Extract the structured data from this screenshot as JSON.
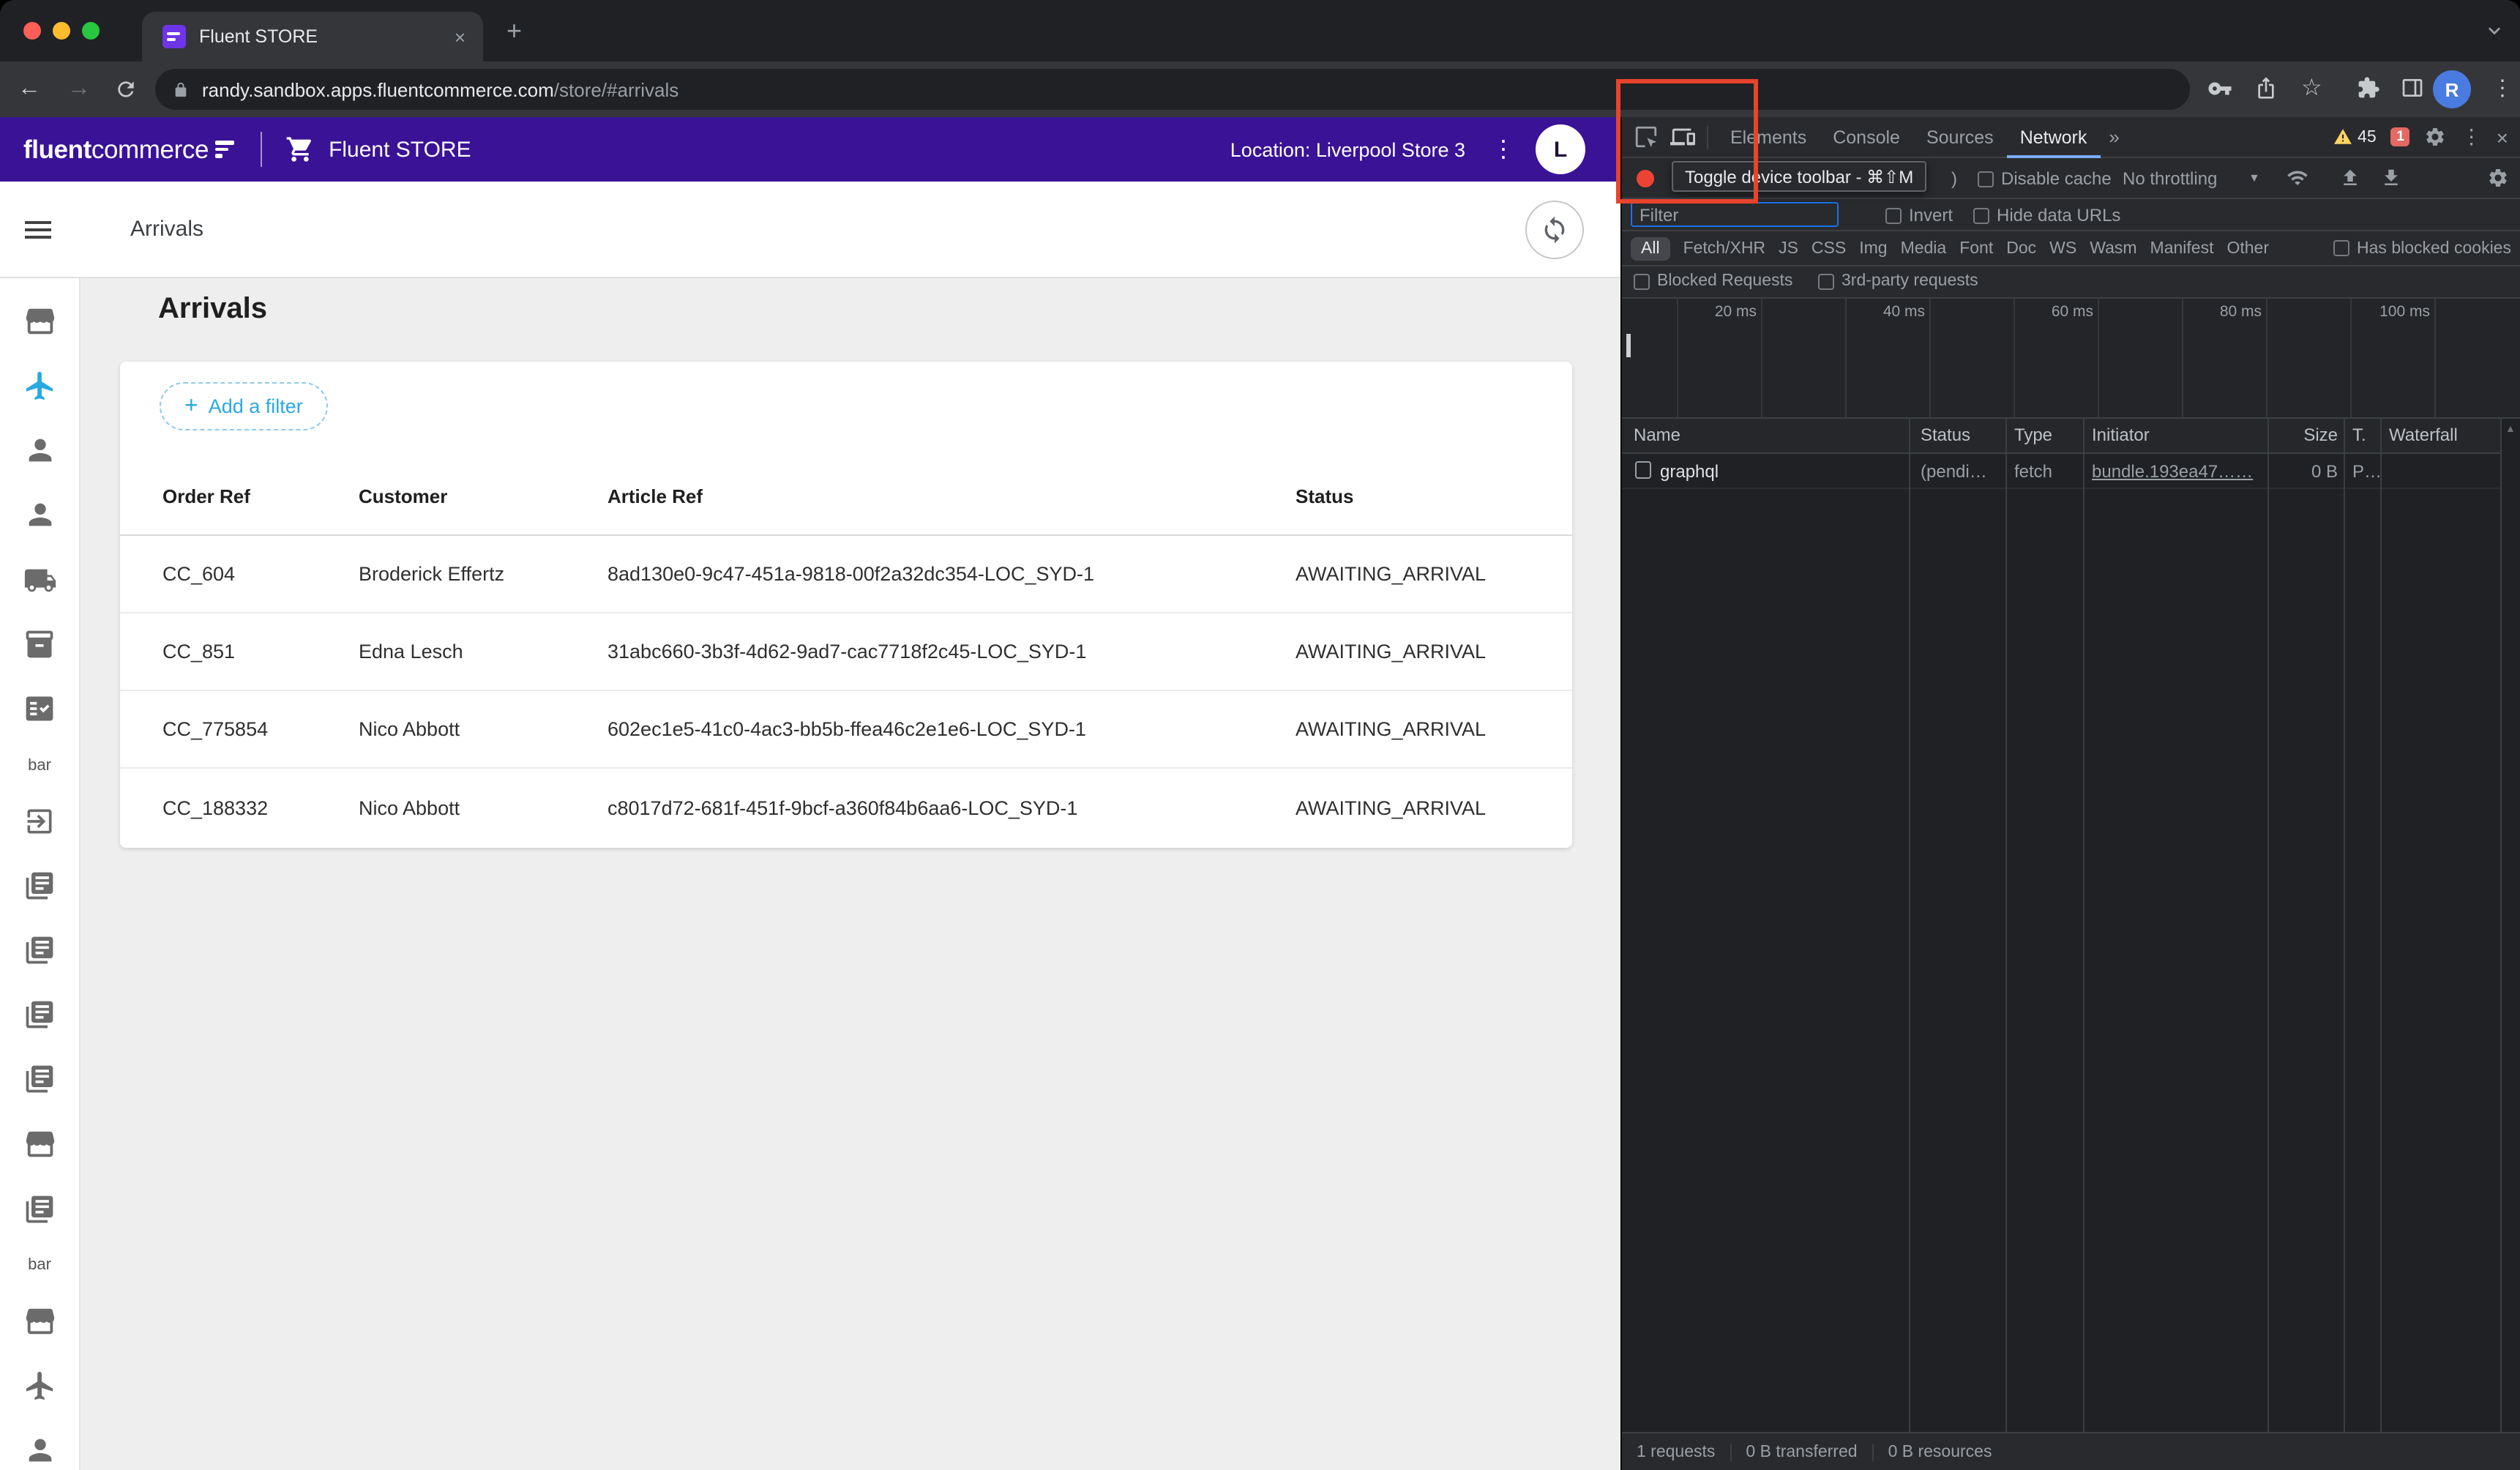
{
  "browser": {
    "tab_title": "Fluent STORE",
    "url_domain": "randy.sandbox.apps.fluentcommerce.com",
    "url_path": "/store/#arrivals",
    "profile_initial": "R"
  },
  "glyphs": {
    "back": "←",
    "forward": "→",
    "star": "☆",
    "kebab": "⋮",
    "close": "×",
    "new_tab": "+",
    "more_tabs": "»",
    "caret_down": "▼",
    "sort_up": "▲",
    "plus": "+"
  },
  "colors": {
    "brand_purple": "#3a1296",
    "accent_blue": "#29a9e2",
    "devtools_warning": "#fdd663",
    "devtools_issue": "#e46962",
    "annotation_red": "#e8432c"
  },
  "app": {
    "header": {
      "logo_bold": "fluent",
      "logo_light": "commerce",
      "product": "Fluent STORE",
      "location": "Location: Liverpool Store 3",
      "avatar_initial": "L"
    },
    "toolbar": {
      "title": "Arrivals"
    },
    "sidebar": {
      "bar_label": "bar",
      "items": [
        "storefront-icon",
        "flight-icon",
        "person-icon",
        "person-icon",
        "truck-icon",
        "package-icon",
        "fact-check-icon",
        "bar-label",
        "exit-icon",
        "library-icon",
        "library-icon",
        "library-icon",
        "library-icon",
        "storefront-icon",
        "library-icon",
        "bar-label",
        "storefront-icon",
        "flight-icon",
        "person-icon"
      ]
    },
    "page": {
      "heading": "Arrivals",
      "add_filter": "Add a filter"
    },
    "table": {
      "columns": [
        "Order Ref",
        "Customer",
        "Article Ref",
        "Status"
      ],
      "rows": [
        {
          "order_ref": "CC_604",
          "customer": "Broderick Effertz",
          "article_ref": "8ad130e0-9c47-451a-9818-00f2a32dc354-LOC_SYD-1",
          "status": "AWAITING_ARRIVAL"
        },
        {
          "order_ref": "CC_851",
          "customer": "Edna Lesch",
          "article_ref": "31abc660-3b3f-4d62-9ad7-cac7718f2c45-LOC_SYD-1",
          "status": "AWAITING_ARRIVAL"
        },
        {
          "order_ref": "CC_775854",
          "customer": "Nico Abbott",
          "article_ref": "602ec1e5-41c0-4ac3-bb5b-ffea46c2e1e6-LOC_SYD-1",
          "status": "AWAITING_ARRIVAL"
        },
        {
          "order_ref": "CC_188332",
          "customer": "Nico Abbott",
          "article_ref": "c8017d72-681f-451f-9bcf-a360f84b6aa6-LOC_SYD-1",
          "status": "AWAITING_ARRIVAL"
        }
      ]
    }
  },
  "devtools": {
    "panel_tabs": [
      "Elements",
      "Console",
      "Sources",
      "Network"
    ],
    "active_tab": "Network",
    "warning_count": "45",
    "issue_count": "1",
    "tooltip": "Toggle device toolbar - ⌘⇧M",
    "network_bar": {
      "obscured_fragment": ")",
      "disable_cache": "Disable cache",
      "throttling": "No throttling"
    },
    "filter_bar": {
      "placeholder": "Filter",
      "invert": "Invert",
      "hide_data_urls": "Hide data URLs"
    },
    "chips": [
      "All",
      "Fetch/XHR",
      "JS",
      "CSS",
      "Img",
      "Media",
      "Font",
      "Doc",
      "WS",
      "Wasm",
      "Manifest",
      "Other"
    ],
    "has_blocked_cookies": "Has blocked cookies",
    "checks_row": {
      "blocked_requests": "Blocked Requests",
      "third_party": "3rd-party requests"
    },
    "timeline": {
      "labels": [
        "20 ms",
        "40 ms",
        "60 ms",
        "80 ms",
        "100 ms"
      ]
    },
    "network": {
      "columns": [
        "Name",
        "Status",
        "Type",
        "Initiator",
        "Size",
        "T.",
        "Waterfall"
      ],
      "rows": [
        {
          "name": "graphql",
          "status": "(pendi…",
          "type": "fetch",
          "initiator": "bundle.193ea47……",
          "size": "0 B",
          "time": "P…"
        }
      ]
    },
    "status_bar": [
      "1 requests",
      "0 B transferred",
      "0 B resources"
    ]
  }
}
